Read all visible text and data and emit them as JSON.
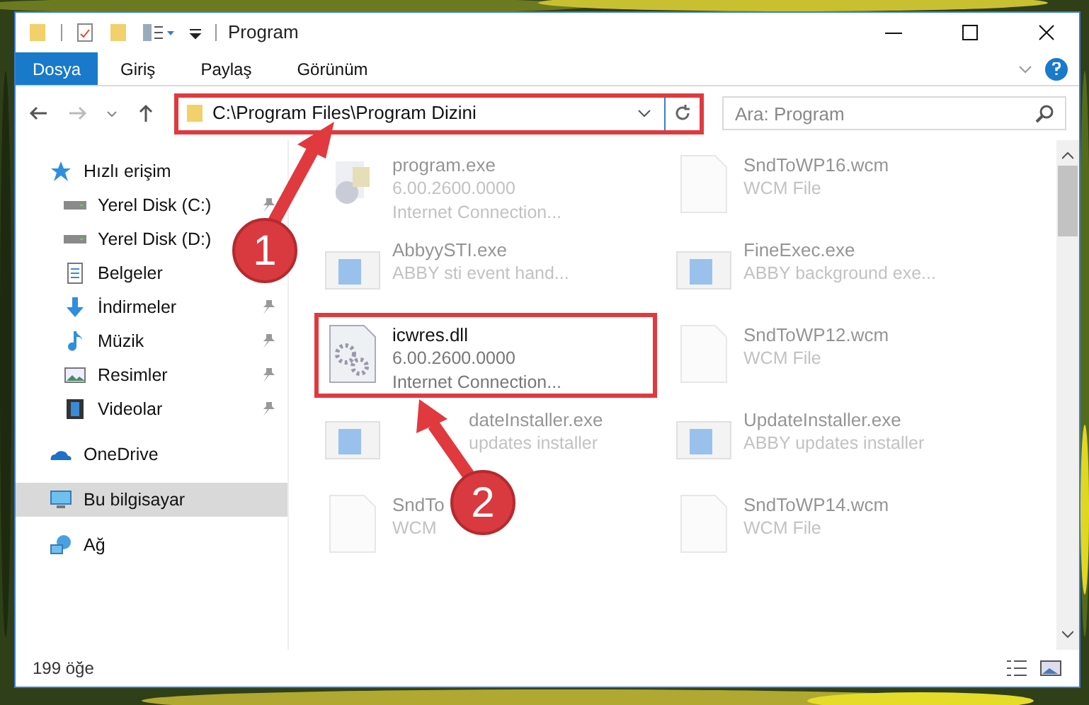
{
  "window": {
    "title": "Program"
  },
  "ribbon_tabs": [
    {
      "label": "Dosya",
      "selected": true
    },
    {
      "label": "Giriş",
      "selected": false
    },
    {
      "label": "Paylaş",
      "selected": false
    },
    {
      "label": "Görünüm",
      "selected": false
    }
  ],
  "address_bar": {
    "path": "C:\\Program Files\\Program Dizini",
    "highlighted": true
  },
  "search": {
    "placeholder": "Ara: Program"
  },
  "navigation": [
    {
      "label": "Hızlı erişim",
      "kind": "star",
      "selected": false,
      "children": [
        {
          "label": "Yerel Disk (C:)",
          "kind": "drive",
          "pinned": true,
          "selected": false
        },
        {
          "label": "Yerel Disk (D:)",
          "kind": "drive",
          "selected": false
        },
        {
          "label": "Belgeler",
          "kind": "document",
          "selected": false
        },
        {
          "label": "İndirmeler",
          "kind": "download",
          "pinned": true,
          "selected": false
        },
        {
          "label": "Müzik",
          "kind": "music",
          "pinned": true,
          "selected": false
        },
        {
          "label": "Resimler",
          "kind": "pictures",
          "pinned": true,
          "selected": false
        },
        {
          "label": "Videolar",
          "kind": "video",
          "pinned": true,
          "selected": false
        }
      ]
    },
    {
      "label": "OneDrive",
      "kind": "cloud",
      "selected": false
    },
    {
      "label": "Bu bilgisayar",
      "kind": "computer",
      "selected": true
    },
    {
      "label": "Ağ",
      "kind": "network",
      "selected": false
    }
  ],
  "files": [
    {
      "name": "program.exe",
      "lines": [
        "6.00.2600.0000",
        "Internet Connection..."
      ],
      "kind": "setup",
      "highlighted": false,
      "covered": false
    },
    {
      "name": "SndToWP16.wcm",
      "lines": [
        "WCM File"
      ],
      "kind": "blank",
      "highlighted": false,
      "covered": false
    },
    {
      "name": "AbbyySTI.exe",
      "lines": [
        "ABBY sti event hand..."
      ],
      "kind": "app",
      "highlighted": false,
      "covered": false
    },
    {
      "name": "FineExec.exe",
      "lines": [
        "ABBY background exe..."
      ],
      "kind": "app",
      "highlighted": false,
      "covered": false
    },
    {
      "name": "icwres.dll",
      "lines": [
        "6.00.2600.0000",
        "Internet Connection..."
      ],
      "kind": "gear",
      "highlighted": true,
      "covered": false
    },
    {
      "name": "SndToWP12.wcm",
      "lines": [
        "WCM File"
      ],
      "kind": "blank",
      "highlighted": false,
      "covered": false
    },
    {
      "name": "dateInstaller.exe",
      "lines": [
        "updates installer"
      ],
      "kind": "app",
      "highlighted": false,
      "covered": true
    },
    {
      "name": "UpdateInstaller.exe",
      "lines": [
        "ABBY updates installer"
      ],
      "kind": "app",
      "highlighted": false,
      "covered": false
    },
    {
      "name": "SndTo",
      "lines": [
        "WCM"
      ],
      "kind": "blank",
      "highlighted": false,
      "covered": false
    },
    {
      "name": "SndToWP14.wcm",
      "lines": [
        "WCM File"
      ],
      "kind": "blank",
      "highlighted": false,
      "covered": false
    }
  ],
  "status_bar": {
    "item_count": "199 öğe"
  },
  "annotations": [
    {
      "label": "1"
    },
    {
      "label": "2"
    }
  ]
}
